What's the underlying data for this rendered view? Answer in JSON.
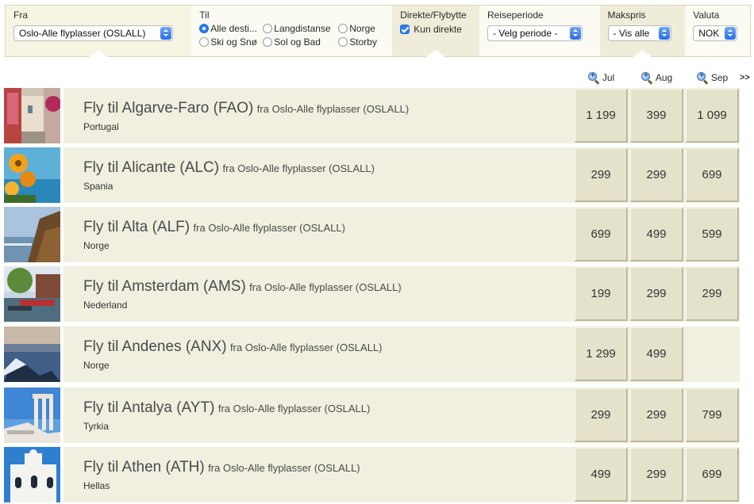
{
  "filters": {
    "fra": {
      "label": "Fra",
      "value": "Oslo-Alle flyplasser (OSLALL)"
    },
    "til": {
      "label": "Til",
      "options": [
        {
          "label": "Alle desti...",
          "selected": true
        },
        {
          "label": "Langdistanse",
          "selected": false
        },
        {
          "label": "Norge",
          "selected": false
        },
        {
          "label": "Ski og Snø",
          "selected": false
        },
        {
          "label": "Sol og Bad",
          "selected": false
        },
        {
          "label": "Storby",
          "selected": false
        }
      ]
    },
    "direkte": {
      "label": "Direkte/Flybytte",
      "checkbox_label": "Kun direkte",
      "checked": true
    },
    "periode": {
      "label": "Reiseperiode",
      "value": "- Velg periode -"
    },
    "makspris": {
      "label": "Makspris",
      "value": "- Vis alle"
    },
    "valuta": {
      "label": "Valuta",
      "value": "NOK"
    }
  },
  "months": [
    "Jul",
    "Aug",
    "Sep"
  ],
  "more_label": ">>",
  "destinations": [
    {
      "title": "Fly til Algarve-Faro (FAO)",
      "from": "fra Oslo-Alle flyplasser (OSLALL)",
      "country": "Portugal",
      "prices": [
        "1 199",
        "399",
        "1 099"
      ],
      "image": "algarve-street-photo"
    },
    {
      "title": "Fly til Alicante (ALC)",
      "from": "fra Oslo-Alle flyplasser (OSLALL)",
      "country": "Spania",
      "prices": [
        "299",
        "299",
        "699"
      ],
      "image": "alicante-flowers-sea-photo"
    },
    {
      "title": "Fly til Alta (ALF)",
      "from": "fra Oslo-Alle flyplasser (OSLALL)",
      "country": "Norge",
      "prices": [
        "699",
        "499",
        "599"
      ],
      "image": "alta-fjord-photo"
    },
    {
      "title": "Fly til Amsterdam (AMS)",
      "from": "fra Oslo-Alle flyplasser (OSLALL)",
      "country": "Nederland",
      "prices": [
        "199",
        "299",
        "299"
      ],
      "image": "amsterdam-canal-photo"
    },
    {
      "title": "Fly til Andenes (ANX)",
      "from": "fra Oslo-Alle flyplasser (OSLALL)",
      "country": "Norge",
      "prices": [
        "1 299",
        "499",
        ""
      ],
      "image": "andenes-coast-photo"
    },
    {
      "title": "Fly til Antalya (AYT)",
      "from": "fra Oslo-Alle flyplasser (OSLALL)",
      "country": "Tyrkia",
      "prices": [
        "299",
        "299",
        "799"
      ],
      "image": "antalya-ruins-photo"
    },
    {
      "title": "Fly til Athen (ATH)",
      "from": "fra Oslo-Alle flyplasser (OSLALL)",
      "country": "Hellas",
      "prices": [
        "499",
        "299",
        "699"
      ],
      "image": "athen-white-church-photo"
    }
  ]
}
